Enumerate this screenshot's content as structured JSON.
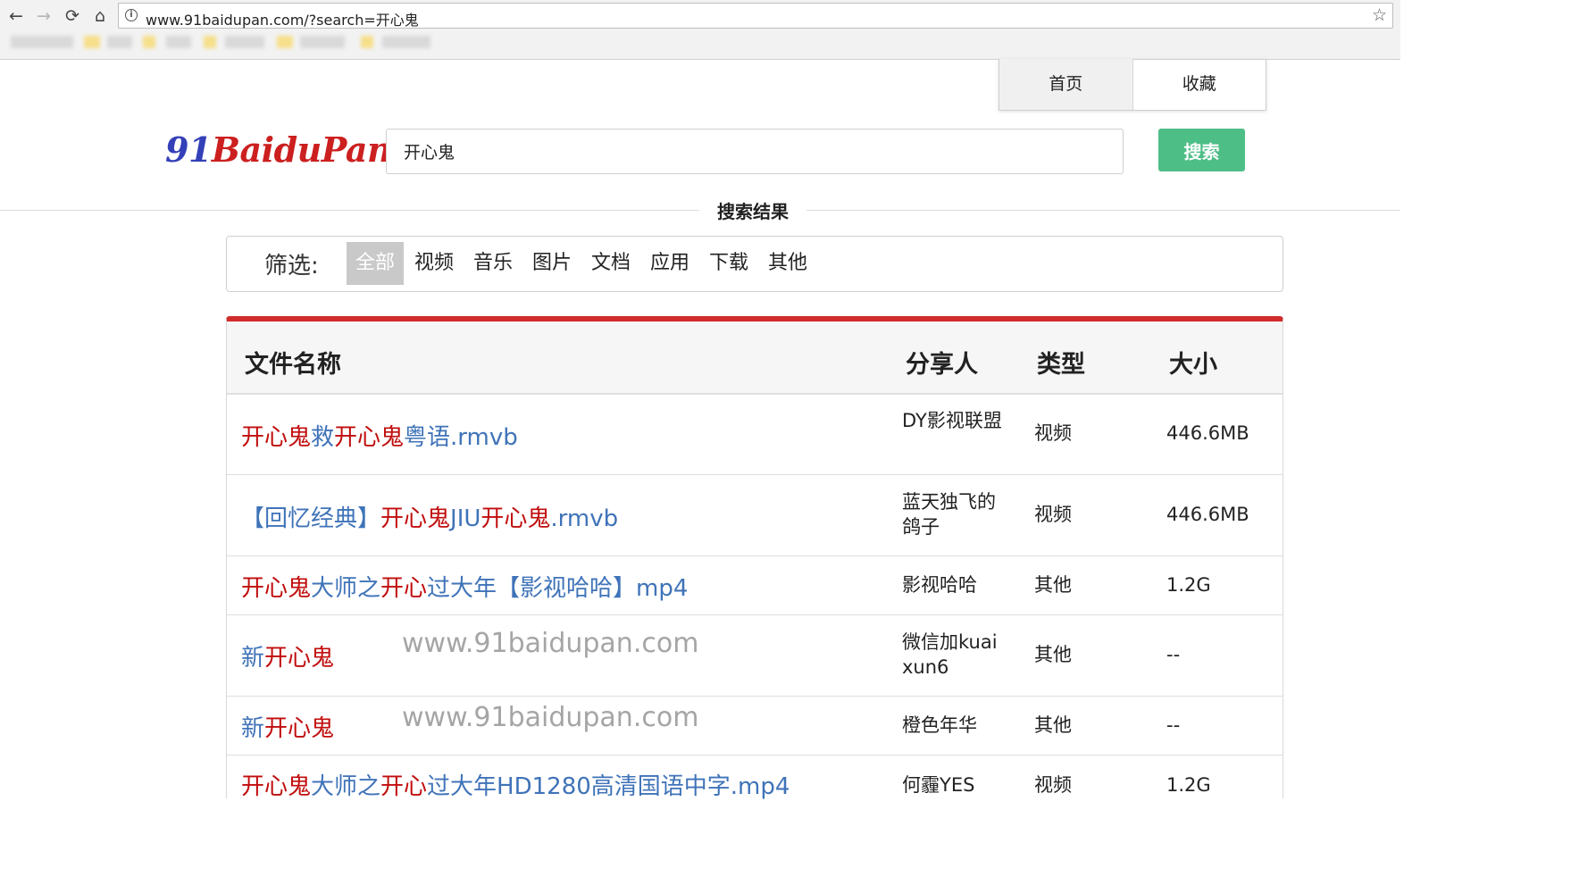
{
  "browser": {
    "url": "www.91baidupan.com/?search=开心鬼",
    "back_icon": "←",
    "forward_icon": "→",
    "reload_icon": "⟳",
    "home_icon": "⌂",
    "star_icon": "☆",
    "info_icon": "i"
  },
  "topnav": {
    "home": "首页",
    "favorites": "收藏"
  },
  "logo": {
    "part1": "91",
    "part2": "B",
    "part3": "aidu",
    "part4": "P",
    "part5": "an"
  },
  "search": {
    "value": "开心鬼",
    "button": "搜索"
  },
  "results_title": "搜索结果",
  "filter": {
    "label": "筛选:",
    "options": [
      "全部",
      "视频",
      "音乐",
      "图片",
      "文档",
      "应用",
      "下载",
      "其他"
    ],
    "active": "全部"
  },
  "table": {
    "headers": {
      "name": "文件名称",
      "sharer": "分享人",
      "type": "类型",
      "size": "大小"
    },
    "rows": [
      {
        "name_parts": [
          [
            "开心鬼",
            "hl"
          ],
          [
            "救",
            "pl"
          ],
          [
            "开心鬼",
            "hl"
          ],
          [
            "粤语.rmvb",
            "pl"
          ]
        ],
        "sharer": "DY影视联盟",
        "type": "视频",
        "size": "446.6MB"
      },
      {
        "name_parts": [
          [
            "【回忆经典】",
            "pl"
          ],
          [
            "开心鬼",
            "hl"
          ],
          [
            "JIU",
            "pl"
          ],
          [
            "开心鬼",
            "hl"
          ],
          [
            ".rmvb",
            "pl"
          ]
        ],
        "sharer": "蓝天独飞的鸽子",
        "type": "视频",
        "size": "446.6MB"
      },
      {
        "name_parts": [
          [
            "开心鬼",
            "hl"
          ],
          [
            "大师之",
            "pl"
          ],
          [
            "开心",
            "hl"
          ],
          [
            "过大年【影视哈哈】mp4",
            "pl"
          ]
        ],
        "sharer": "影视哈哈",
        "type": "其他",
        "size": "1.2G"
      },
      {
        "name_parts": [
          [
            "新",
            "pl"
          ],
          [
            "开心鬼",
            "hl"
          ]
        ],
        "sharer": "微信加kuaixun6",
        "type": "其他",
        "size": "--"
      },
      {
        "name_parts": [
          [
            "新",
            "pl"
          ],
          [
            "开心鬼",
            "hl"
          ]
        ],
        "sharer": "橙色年华",
        "type": "其他",
        "size": "--"
      },
      {
        "name_parts": [
          [
            "开心鬼",
            "hl"
          ],
          [
            "大师之",
            "pl"
          ],
          [
            "开心",
            "hl"
          ],
          [
            "过大年HD1280高清国语中字.mp4",
            "pl"
          ]
        ],
        "sharer": "何霾YES",
        "type": "视频",
        "size": "1.2G"
      }
    ],
    "watermark": "www.91baidupan.com"
  },
  "colors": {
    "accent_red": "#d12b2b",
    "highlight_red": "#c10d0d",
    "link_blue": "#3f73b8",
    "search_green": "#4ebe87"
  }
}
